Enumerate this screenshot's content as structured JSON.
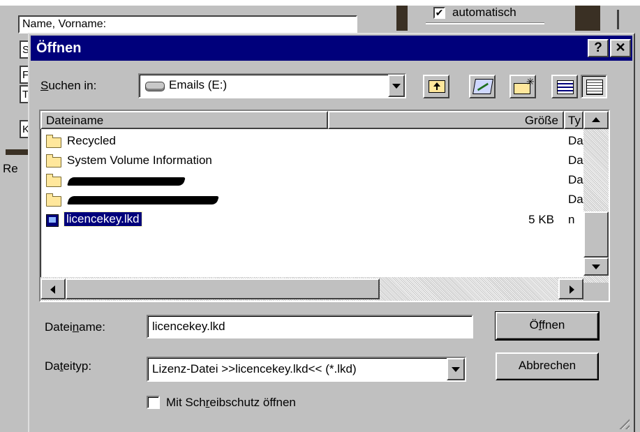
{
  "background_app": {
    "partial_field_label": "Name, Vorname:",
    "checkbox_label": "automatisch",
    "checkbox_checked": "✔",
    "left_stub_letters": [
      "S",
      "F",
      "T",
      "K"
    ],
    "partial_label_re": "Re"
  },
  "dialog": {
    "title": "Öffnen",
    "help_button": "?",
    "close_button": "✕",
    "look_in": {
      "label_pre": "",
      "label_u": "S",
      "label_post": "uchen in:",
      "value": "Emails (E:)"
    },
    "toolbar": {
      "up_folder": "up-one-level",
      "desktop": "desktop",
      "new_folder": "new-folder",
      "list_view": "list-view",
      "details_view": "details-view"
    },
    "file_list": {
      "columns": [
        "Dateiname",
        "Größe",
        "Ty"
      ],
      "rows": [
        {
          "name": "Recycled",
          "size": "",
          "type": "Da",
          "icon": "folder-icon"
        },
        {
          "name": "System Volume Information",
          "size": "",
          "type": "Da",
          "icon": "folder-icon"
        },
        {
          "name": "",
          "size": "",
          "type": "Da",
          "icon": "folder-icon",
          "redacted": true
        },
        {
          "name": "",
          "size": "",
          "type": "Da",
          "icon": "folder-icon",
          "redacted": true
        },
        {
          "name": "licencekey.lkd",
          "size": "5 KB",
          "type": "n",
          "icon": "file-icon",
          "selected": true
        }
      ]
    },
    "filename": {
      "label_pre": "Datei",
      "label_u": "n",
      "label_post": "ame:",
      "value": "licencekey.lkd"
    },
    "filetype": {
      "label_pre": "Da",
      "label_u": "t",
      "label_post": "eityp:",
      "value": "Lizenz-Datei >>licencekey.lkd<< (*.lkd)"
    },
    "open_button": {
      "pre": "Ö",
      "u": "f",
      "post": "fnen"
    },
    "cancel_button": "Abbrechen",
    "readonly": {
      "pre": "Mit Sch",
      "u": "r",
      "post": "eibschutz öffnen"
    },
    "selection_color": "#00007b",
    "title_color": "#00007b"
  }
}
